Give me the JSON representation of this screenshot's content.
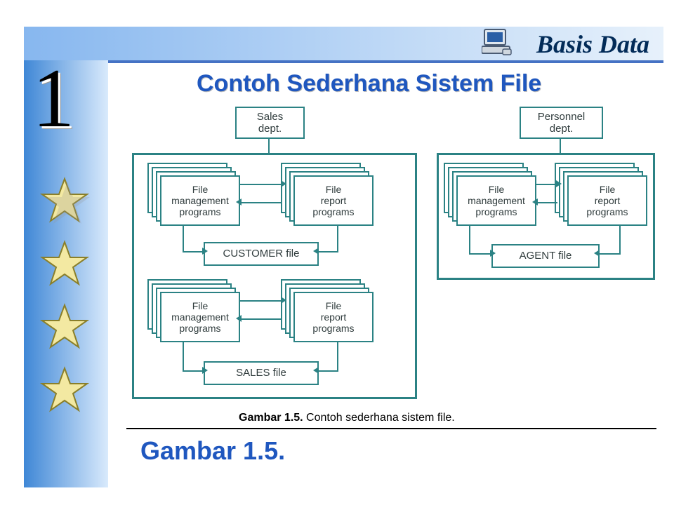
{
  "header": {
    "title": "Basis Data"
  },
  "chapter": {
    "number": "1"
  },
  "content": {
    "title": "Contoh Sederhana Sistem File",
    "caption_bold": "Gambar 1.5.",
    "caption_rest": " Contoh sederhana sistem file.",
    "bottom_title": "Gambar 1.5."
  },
  "diagram": {
    "dept_sales": "Sales\ndept.",
    "dept_personnel": "Personnel\ndept.",
    "stack_mgmt": "File\nmanagement\nprograms",
    "stack_report": "File\nreport\nprograms",
    "file_customer": "CUSTOMER file",
    "file_sales": "SALES file",
    "file_agent": "AGENT file"
  },
  "icons": {
    "computer": "computer-icon",
    "star": "star-icon"
  },
  "colors": {
    "accent_blue": "#1f57bf",
    "diagram_teal": "#2b8284",
    "header_gradient_from": "#87b7ef",
    "header_rule": "#4572c4"
  }
}
